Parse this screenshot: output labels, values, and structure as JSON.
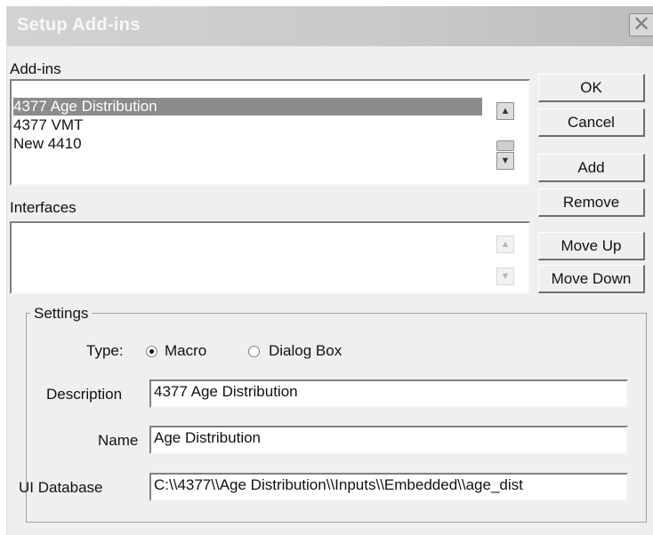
{
  "dialog": {
    "title": "Setup Add-ins",
    "close_glyph": "✕"
  },
  "addins": {
    "label": "Add-ins",
    "items": [
      {
        "label": "4377 Age Distribution",
        "selected": true
      },
      {
        "label": "4377 VMT",
        "selected": false
      },
      {
        "label": "New 4410",
        "selected": false
      }
    ]
  },
  "interfaces": {
    "label": "Interfaces",
    "items": []
  },
  "buttons": {
    "ok": "OK",
    "cancel": "Cancel",
    "add": "Add",
    "remove": "Remove",
    "move_up": "Move Up",
    "move_down": "Move Down"
  },
  "settings": {
    "legend": "Settings",
    "type_label": "Type:",
    "type_options": [
      {
        "label": "Macro",
        "checked": true
      },
      {
        "label": "Dialog Box",
        "checked": false
      }
    ],
    "description_label": "Description",
    "description_value": "4377 Age Distribution",
    "name_label": "Name",
    "name_value": "Age Distribution",
    "ui_database_label": "UI Database",
    "ui_database_value": "C:\\\\4377\\\\Age Distribution\\\\Inputs\\\\Embedded\\\\age_dist"
  },
  "icons": {
    "scroll_up": "▲",
    "scroll_down": "▼"
  }
}
